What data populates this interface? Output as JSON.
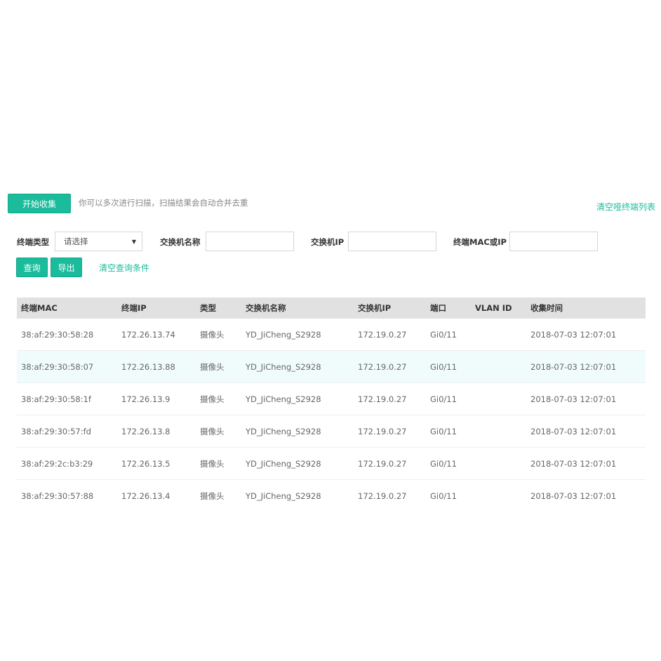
{
  "toolbar": {
    "scan_button": "开始收集",
    "scan_hint": "你可以多次进行扫描，扫描结果会自动合并去重",
    "clear_dumb_list": "清空哑终端列表"
  },
  "filters": {
    "type_label": "终端类型",
    "type_selected": "请选择",
    "switch_name_label": "交换机名称",
    "switch_name_value": "",
    "switch_ip_label": "交换机IP",
    "switch_ip_value": "",
    "mac_ip_label": "终端MAC或IP",
    "mac_ip_value": "",
    "query_button": "查询",
    "export_button": "导出",
    "clear_conditions": "清空查询条件"
  },
  "table": {
    "columns": [
      "终端MAC",
      "终端IP",
      "类型",
      "交换机名称",
      "交换机IP",
      "端口",
      "VLAN ID",
      "收集时间"
    ],
    "rows": [
      [
        "38:af:29:30:58:28",
        "172.26.13.74",
        "摄像头",
        "YD_JiCheng_S2928",
        "172.19.0.27",
        "Gi0/11",
        "",
        "2018-07-03 12:07:01"
      ],
      [
        "38:af:29:30:58:07",
        "172.26.13.88",
        "摄像头",
        "YD_JiCheng_S2928",
        "172.19.0.27",
        "Gi0/11",
        "",
        "2018-07-03 12:07:01"
      ],
      [
        "38:af:29:30:58:1f",
        "172.26.13.9",
        "摄像头",
        "YD_JiCheng_S2928",
        "172.19.0.27",
        "Gi0/11",
        "",
        "2018-07-03 12:07:01"
      ],
      [
        "38:af:29:30:57:fd",
        "172.26.13.8",
        "摄像头",
        "YD_JiCheng_S2928",
        "172.19.0.27",
        "Gi0/11",
        "",
        "2018-07-03 12:07:01"
      ],
      [
        "38:af:29:2c:b3:29",
        "172.26.13.5",
        "摄像头",
        "YD_JiCheng_S2928",
        "172.19.0.27",
        "Gi0/11",
        "",
        "2018-07-03 12:07:01"
      ],
      [
        "38:af:29:30:57:88",
        "172.26.13.4",
        "摄像头",
        "YD_JiCheng_S2928",
        "172.19.0.27",
        "Gi0/11",
        "",
        "2018-07-03 12:07:01"
      ]
    ]
  },
  "colors": {
    "accent": "#1abc9c",
    "header_bg": "#e1e1e1",
    "row_highlight": "#f0fcfc"
  }
}
